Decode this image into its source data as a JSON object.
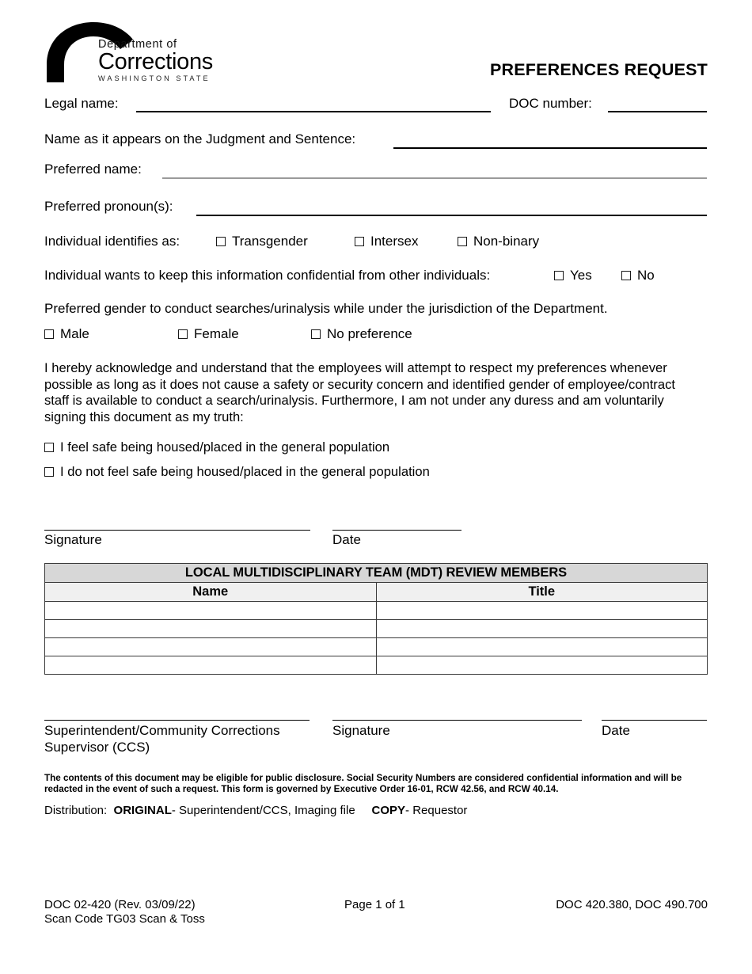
{
  "document": {
    "title": "PREFERENCES REQUEST",
    "agency": {
      "line1": "Department of",
      "line2": "Corrections",
      "line3": "WASHINGTON STATE"
    }
  },
  "fields": {
    "legal_name_label": "Legal name:",
    "doc_number_label": "DOC number:",
    "judgment_label": "Name as it appears on the Judgment and Sentence:",
    "preferred_name_label": "Preferred name:",
    "preferred_pronouns_label": "Preferred pronoun(s):"
  },
  "identity": {
    "prompt": "Individual identifies as:",
    "options": [
      {
        "label": "Transgender",
        "checked": false
      },
      {
        "label": "Intersex",
        "checked": false
      },
      {
        "label": "Non-binary",
        "checked": false
      }
    ]
  },
  "confidential": {
    "prompt": "Individual wants to keep this information confidential from other individuals:",
    "options": [
      {
        "label": "Yes",
        "checked": false
      },
      {
        "label": "No",
        "checked": false
      }
    ]
  },
  "search_gender": {
    "prompt": "Preferred gender to conduct searches/urinalysis while under the jurisdiction of the Department.",
    "options": [
      {
        "label": "Male",
        "checked": false
      },
      {
        "label": "Female",
        "checked": false
      },
      {
        "label": "No preference",
        "checked": false
      }
    ]
  },
  "acknowledgment": {
    "text": "I hereby acknowledge and understand that the employees will attempt to respect my preferences whenever possible as long as it does not cause a safety or security concern and identified gender of employee/contract staff is available to conduct a search/urinalysis.  Furthermore, I am not under any duress and am voluntarily signing this document as my truth:",
    "options": [
      {
        "label": "I feel safe being housed/placed in the general population",
        "checked": false
      },
      {
        "label": "I do not feel safe being housed/placed in the general population",
        "checked": false
      }
    ]
  },
  "signature_block": {
    "signature_label": "Signature",
    "date_label": "Date"
  },
  "mdt_table": {
    "title": "LOCAL MULTIDISCIPLINARY TEAM (MDT) REVIEW MEMBERS",
    "columns": [
      "Name",
      "Title"
    ],
    "rows": [
      [
        "",
        ""
      ],
      [
        "",
        ""
      ],
      [
        "",
        ""
      ],
      [
        "",
        ""
      ]
    ]
  },
  "approval_block": {
    "superintendent_label_line1": "Superintendent/Community Corrections",
    "superintendent_label_line2": "Supervisor (CCS)",
    "signature_label": "Signature",
    "date_label": "Date"
  },
  "disclosure": {
    "text": "The contents of this document may be eligible for public disclosure.  Social Security Numbers are considered confidential information and will be redacted in the event of such a request.  This form is governed by Executive Order 16-01, RCW 42.56, and RCW 40.14."
  },
  "distribution": {
    "label": "Distribution:",
    "original_tag": "ORIGINAL",
    "original_text": " - Superintendent/CCS, Imaging file",
    "copy_tag": "COPY",
    "copy_text": " - Requestor"
  },
  "footer": {
    "form_number": "DOC 02-420 (Rev. 03/09/22)",
    "scan_code": "Scan Code TG03 Scan & Toss",
    "page": "Page 1 of 1",
    "policy_refs": "DOC 420.380, DOC 490.700"
  },
  "colors": {
    "table_header_bg": "#d7d7d7",
    "table_subheader_bg": "#f0f0f0",
    "rule_black": "#000000",
    "rule_gray": "#9a9a9a"
  }
}
